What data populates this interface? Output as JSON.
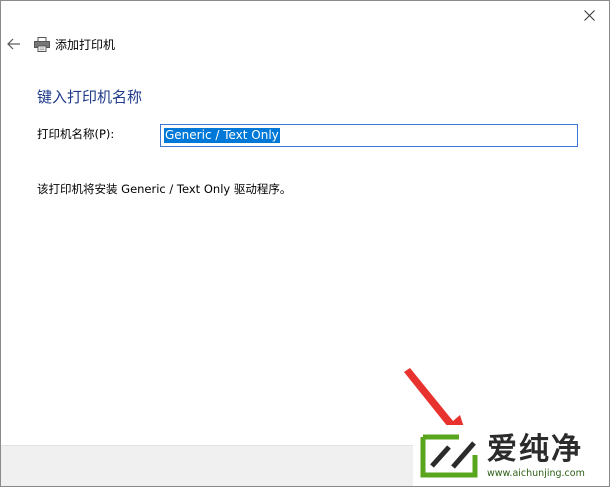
{
  "window": {
    "title": "添加打印机",
    "close_icon": "close-icon",
    "back_icon": "back-arrow-icon",
    "printer_icon": "printer-icon"
  },
  "content": {
    "heading": "键入打印机名称",
    "name_label": "打印机名称(P):",
    "name_value": "Generic / Text Only",
    "driver_note": "该打印机将安装 Generic / Text Only 驱动程序。"
  },
  "watermark": {
    "text": "爱纯净",
    "url": "www.aichunjing.com"
  },
  "colors": {
    "heading": "#1f3b8a",
    "selection": "#0078d7",
    "input_border": "#3b79d4",
    "footer": "#f0f0f0",
    "arrow": "#e8322d",
    "watermark_green": "#5aa51e"
  }
}
